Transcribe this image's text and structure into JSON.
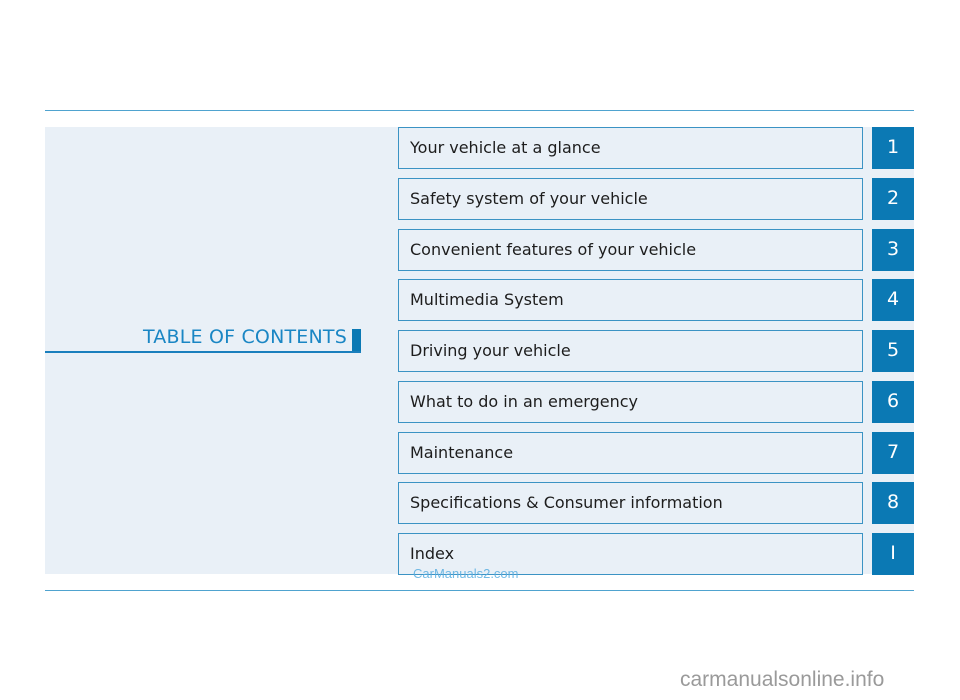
{
  "title": "TABLE OF CONTENTS",
  "colors": {
    "accent": "#0b79b4",
    "panel": "#e9f0f7",
    "border": "#3b93c4",
    "rule": "#4fa3cf"
  },
  "chapters": [
    {
      "number": "1",
      "label": "Your vehicle at a glance"
    },
    {
      "number": "2",
      "label": "Safety system of your vehicle"
    },
    {
      "number": "3",
      "label": "Convenient features of your vehicle"
    },
    {
      "number": "4",
      "label": "Multimedia System"
    },
    {
      "number": "5",
      "label": "Driving your vehicle"
    },
    {
      "number": "6",
      "label": "What to do in an emergency"
    },
    {
      "number": "7",
      "label": "Maintenance"
    },
    {
      "number": "8",
      "label": "Specifications & Consumer information"
    },
    {
      "number": "I",
      "label": "Index"
    }
  ],
  "watermarks": {
    "small": "CarManuals2.com",
    "large": "carmanualsonline.info"
  }
}
